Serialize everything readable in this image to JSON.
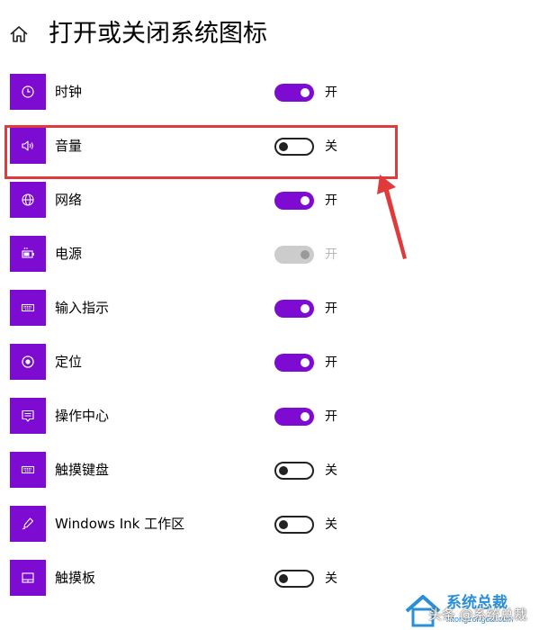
{
  "header": {
    "title": "打开或关闭系统图标",
    "home_icon": "home-icon"
  },
  "colors": {
    "accent": "#7e0bd1",
    "annotation": "#e03a3a"
  },
  "items": [
    {
      "label": "时钟",
      "state": "开",
      "on": true,
      "icon": "clock-icon"
    },
    {
      "label": "音量",
      "state": "关",
      "on": false,
      "icon": "volume-icon"
    },
    {
      "label": "网络",
      "state": "开",
      "on": true,
      "icon": "globe-icon"
    },
    {
      "label": "电源",
      "state": "开",
      "on": true,
      "disabled": true,
      "icon": "battery-icon"
    },
    {
      "label": "输入指示",
      "state": "开",
      "on": true,
      "icon": "keyboard-icon"
    },
    {
      "label": "定位",
      "state": "开",
      "on": true,
      "icon": "location-icon"
    },
    {
      "label": "操作中心",
      "state": "开",
      "on": true,
      "icon": "action-center-icon"
    },
    {
      "label": "触摸键盘",
      "state": "关",
      "on": false,
      "icon": "touch-keyboard-icon"
    },
    {
      "label": "Windows Ink 工作区",
      "state": "关",
      "on": false,
      "icon": "pen-icon"
    },
    {
      "label": "触摸板",
      "state": "关",
      "on": false,
      "icon": "touchpad-icon"
    }
  ],
  "watermark": {
    "text": "头条 @系统总裁"
  }
}
